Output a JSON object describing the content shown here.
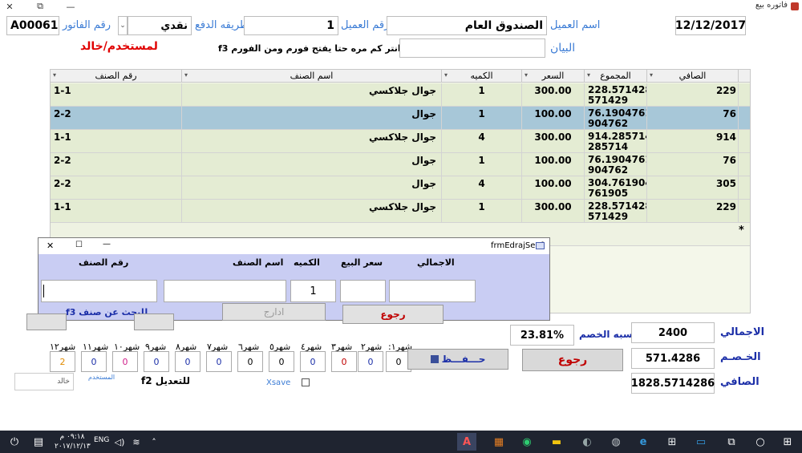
{
  "window": {
    "title": "فاتوره بيع",
    "close": "✕",
    "restore": "⧉",
    "minimize": "—"
  },
  "header": {
    "invoice_no_label": "رقم الفاتور",
    "invoice_no": "A00061",
    "payment_label": "طريقه الدفع",
    "payment_value": "نقدي",
    "customer_no_label": "رقم العميل",
    "customer_no": "1",
    "customer_name_label": "اسم العميل",
    "customer_name": "الصندوق العام",
    "date": "12/12/2017",
    "user_label": "لمستخدم/خالد",
    "statement_label": "البيان",
    "hint_add": "للاضافه انتر كم مره حتا يفتح فورم ومن الفورم f3"
  },
  "grid": {
    "columns": [
      "الصافي",
      "المجموع",
      "السعر",
      "الكميه",
      "اسم الصنف",
      "رقم الصنف"
    ],
    "rows": [
      {
        "net": "229",
        "total1": "228.571428",
        "total2": "571429",
        "price": "300.00",
        "qty": "1",
        "name": "جوال جلاكسي",
        "code": "1-1",
        "selected": false
      },
      {
        "net": "76",
        "total1": "76.1904761",
        "total2": "904762",
        "price": "100.00",
        "qty": "1",
        "name": "جوال",
        "code": "2-2",
        "selected": true
      },
      {
        "net": "914",
        "total1": "914.285714",
        "total2": "285714",
        "price": "300.00",
        "qty": "4",
        "name": "جوال جلاكسي",
        "code": "1-1",
        "selected": false
      },
      {
        "net": "76",
        "total1": "76.1904761",
        "total2": "904762",
        "price": "100.00",
        "qty": "1",
        "name": "جوال",
        "code": "2-2",
        "selected": false
      },
      {
        "net": "305",
        "total1": "304.761904",
        "total2": "761905",
        "price": "100.00",
        "qty": "4",
        "name": "جوال",
        "code": "2-2",
        "selected": false
      },
      {
        "net": "229",
        "total1": "228.571428",
        "total2": "571429",
        "price": "300.00",
        "qty": "1",
        "name": "جوال جلاكسي",
        "code": "1-1",
        "selected": false
      }
    ],
    "new_row_marker": "*"
  },
  "dialog": {
    "title": "frmEdrajSenf",
    "close": "✕",
    "maximize": "☐",
    "minimize": "—",
    "code_label": "رقم الصنف",
    "name_label": "اسم الصنف",
    "qty_label": "الكميه",
    "price_label": "سعر البيع",
    "total_label": "الاجمالي",
    "qty_value": "1",
    "insert_button": "ادارج",
    "back_button": "رجوع",
    "search_hint": "للبحث عن صنف f3"
  },
  "months": {
    "labels": [
      "شهر١٢",
      "شهر١١",
      "شهر١٠",
      "شهر٩",
      "شهر٨",
      "شهر٧",
      "شهر٦",
      "شهر٥",
      "شهر٤",
      "شهر٣",
      "شهر٢",
      "شهر١:"
    ],
    "values": [
      "2",
      "0",
      "0",
      "0",
      "0",
      "0",
      "0",
      "0",
      "0",
      "0",
      "0",
      "0"
    ]
  },
  "footer": {
    "save_button": "حـــفـــظ",
    "back_button": "رجوع",
    "edit_hint": "للتعديل f2",
    "user_value": "خالد",
    "user_caption": "المستخدم",
    "xsave_label": "Xsave"
  },
  "totals": {
    "discount_pct_label": "نسبه الخصم",
    "discount_pct": "23.81%",
    "total_label": "الاجمالي",
    "total": "2400",
    "discount_label": "الخـصـم",
    "discount": "571.4286",
    "net_label": "الصافي",
    "net": "1828.5714286"
  },
  "taskbar": {
    "time": "٠٩:١٨ م",
    "date": "٢٠١٧/١٢/١٣",
    "lang": "ENG"
  },
  "colors": {
    "grid_row": "#e4ecd3",
    "selected_row": "#a7c7d8",
    "dialog_bg": "#c9cdf3",
    "accent_label": "#3a7bd5"
  }
}
